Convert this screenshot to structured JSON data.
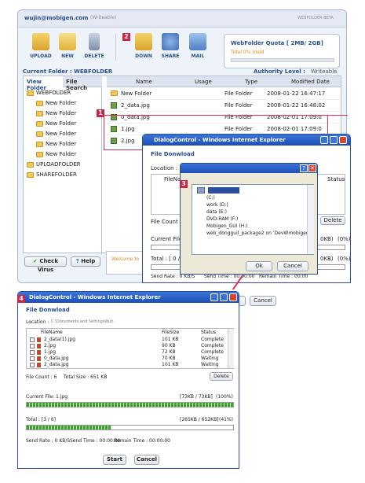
{
  "webfolder": {
    "user": "wujin@mobigen.com",
    "user_suffix": "(Writeable)",
    "brand": "WEBFOLDER BETA",
    "toolbar": {
      "upload": "UPLOAD",
      "new": "NEW",
      "delete": "DELETE",
      "down": "DOWN",
      "share": "SHARE",
      "mail": "MAIL"
    },
    "quota": {
      "title": "WebFolder Quota [ 2MB/ 2GB]",
      "used": "Total 0% Used"
    },
    "current_folder": "Current Folder : WEBFOLDER",
    "authority": "Authority Level :",
    "authority_value": "Writeable",
    "tabs": {
      "view": "View Folder",
      "search": "File Search"
    },
    "tree": [
      {
        "label": "WEBFOLDER"
      },
      {
        "label": "New Folder"
      },
      {
        "label": "New Folder"
      },
      {
        "label": "New Folder"
      },
      {
        "label": "New Folder"
      },
      {
        "label": "New Folder"
      },
      {
        "label": "New Folder"
      },
      {
        "label": "UPLOADFOLDER"
      },
      {
        "label": "SHAREFOLDER"
      }
    ],
    "columns": {
      "name": "Name",
      "usage": "Usage",
      "type": "Type",
      "modified": "Modified Date"
    },
    "rows": [
      {
        "name": "New Folder",
        "usage": "",
        "type": "File Folder",
        "date": "2008-01-22 16:47:17"
      },
      {
        "name": "2_data.jpg",
        "usage": "",
        "type": "File Folder",
        "date": "2008-01-22 16:48:02"
      },
      {
        "name": "0_data.jpg",
        "usage": "",
        "type": "File Folder",
        "date": "2008-02-01 17:09:0"
      },
      {
        "name": "1.jpg",
        "usage": "",
        "type": "File Folder",
        "date": "2008-02-01 17:09:0"
      },
      {
        "name": "2.jpg",
        "usage": "",
        "type": "File Folder",
        "date": "2008-02-01 17:09:0"
      }
    ],
    "check_virus": "Check Virus",
    "help": "Help",
    "welcome": "Welcome to"
  },
  "badges": {
    "b1": "1",
    "b2": "2",
    "b3": "3",
    "b4": "4"
  },
  "dlg1": {
    "title": "DialogControl - Windows Internet Explorer",
    "section": "File Donwload",
    "location": "Location :",
    "filename_col": "FileName",
    "status_col": "Status",
    "file_count": "File Count : 0",
    "delete": "Delete",
    "current_file": "Current File:",
    "pct1": "0KB)",
    "pct1b": "(0%)",
    "total": "Total : [ 0 / 0",
    "pct2": "0KB)",
    "pct2b": "(0%)",
    "send_rate": "Send Rate : 0 KB/S",
    "send_time": "Send Time : 00:00:00",
    "remain": "Remain Time : 00:00",
    "cancel": "Cancel"
  },
  "browse": {
    "help": "?",
    "items": [
      "(C:)",
      "work (D:)",
      "data (E:)",
      "DVD-RAM (F:)",
      "Mobigen_GUI (H:)",
      "web_dongguil_package2 on 'DevWmobiger"
    ],
    "ok": "Ok",
    "cancel": "Cancel"
  },
  "dlg2": {
    "title": "DialogControl - Windows Internet Explorer",
    "section": "File Donwload",
    "location_label": "Location :",
    "location_value": "C:\\Documents and Settings\\Kuh",
    "cols": {
      "name": "FileName",
      "size": "FileSize",
      "status": "Status"
    },
    "rows": [
      {
        "name": "2_data(1).jpg",
        "size": "101 KB",
        "status": "Complete"
      },
      {
        "name": "2.jpg",
        "size": "90 KB",
        "status": "Complete"
      },
      {
        "name": "1.jpg",
        "size": "72 KB",
        "status": "Complete"
      },
      {
        "name": "0_data.jpg",
        "size": "70 KB",
        "status": "Waiting"
      },
      {
        "name": "2_data.jpg",
        "size": "101 KB",
        "status": "Waiting"
      }
    ],
    "file_count": "File Count : 6",
    "total_size": "Total Size : 651 KB",
    "delete": "Delete",
    "current_label": "Current File:",
    "current_value": "1.jpg",
    "current_kb": "[73KB / 73KB]",
    "current_pct": "(100%)",
    "current_fill": 1.0,
    "total_label": "Total : [3 / 6]",
    "total_kb": "[265KB / 652KB]",
    "total_pct": "(41%)",
    "total_fill": 0.41,
    "send_rate": "Send Rate : 0 KB/S",
    "send_time": "Send Time : 00:00:00",
    "remain": "Remain Time : 00:00:00",
    "start": "Start",
    "cancel": "Cancel"
  },
  "colors": {
    "accent": "#2a4f8e",
    "badge": "#cc2444",
    "ie_bar": "#1d4fb6",
    "progress": "#3aa32c",
    "highlight": "#d8315b"
  }
}
